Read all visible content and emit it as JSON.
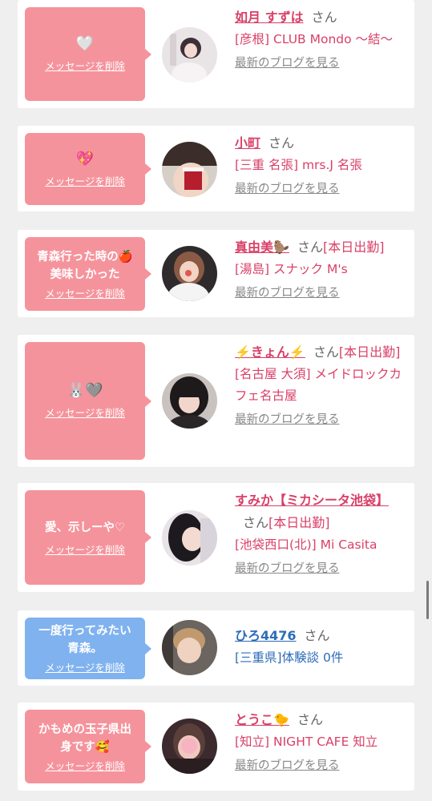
{
  "delete_label": "メッセージを削除",
  "blog_label": "最新のブログを見る",
  "san_label": "さん",
  "colors": {
    "pink_bubble": "#f5939c",
    "blue_bubble": "#7fb2ef",
    "pink_text": "#d94068",
    "blue_text": "#2c6cb8"
  },
  "favorites": [
    {
      "message": "",
      "emoji": "🤍",
      "name": "如月 すずは",
      "status": "",
      "shop": "[彦根] CLUB Mondo 〜結〜"
    },
    {
      "message": "",
      "emoji": "💖",
      "name": "小町",
      "status": "",
      "shop": "[三重 名張] mrs.J 名張"
    },
    {
      "message": "青森行った時の🍎\n美味しかった",
      "emoji": "",
      "name": "真由美🦫",
      "status": "[本日出勤]",
      "shop": "[湯島] スナック M's"
    },
    {
      "message": "",
      "emoji": "🐰🩶",
      "name": "⚡️きょん⚡️",
      "status": "[本日出勤]",
      "shop": "[名古屋 大須] メイドロックカフェ名古屋"
    },
    {
      "message": "愛、示しーや♡",
      "emoji": "",
      "name": "すみか【ミカシータ池袋】",
      "status": "[本日出勤]",
      "shop": "[池袋西口(北)] Mi Casita"
    },
    {
      "message": "一度行ってみたい\n青森。",
      "emoji": "",
      "name": "ひろ4476",
      "status": "",
      "shop": "[三重県]体験談 0件"
    },
    {
      "message": "かもめの玉子県出\n身です🥰",
      "emoji": "",
      "name": "とうこ🐤",
      "status": "",
      "shop": "[知立] NIGHT CAFE 知立"
    }
  ]
}
